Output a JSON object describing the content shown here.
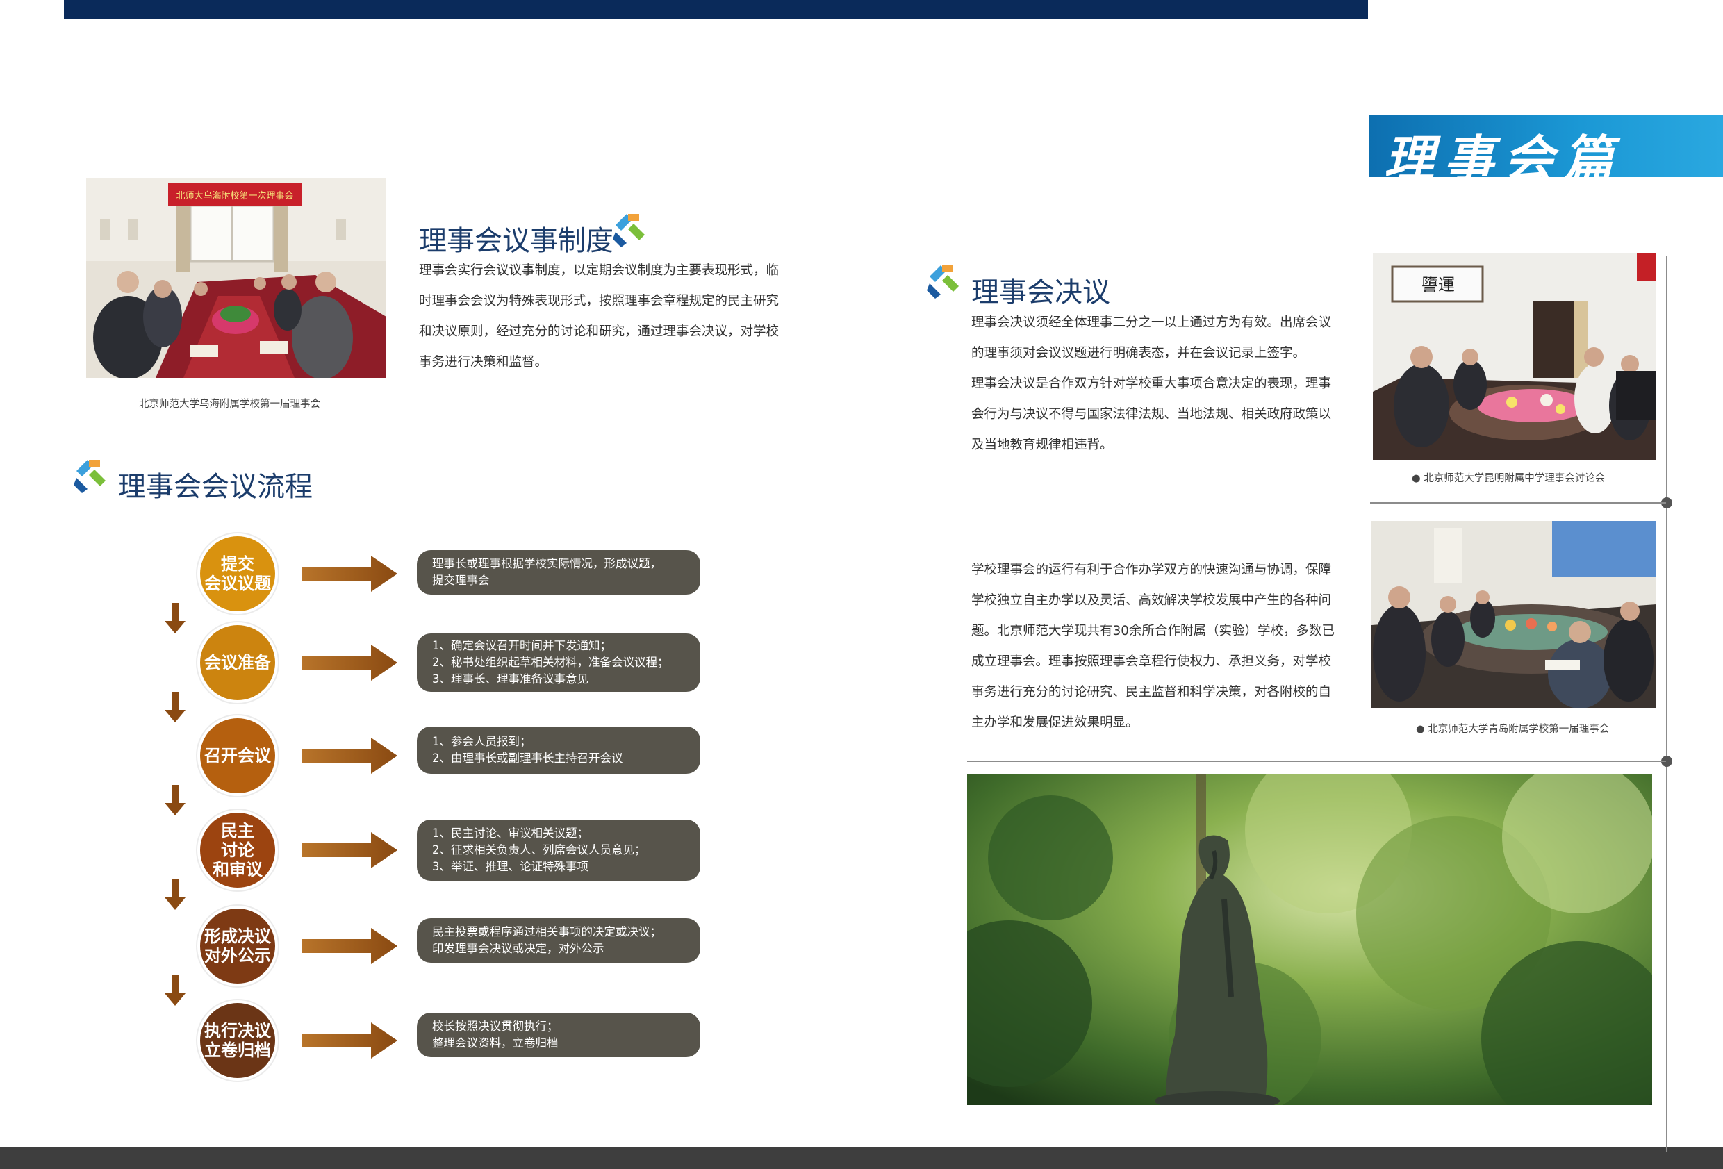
{
  "section_title": "理事会篇",
  "meeting_system": {
    "title": "理事会议事制度",
    "body": "理事会实行会议议事制度，以定期会议制度为主要表现形式，临时理事会会议为特殊表现形式，按照理事会章程规定的民主研究和决议原则，经过充分的讨论和研究，通过理事会决议，对学校事务进行决策和监督。",
    "photo_caption": "北京师范大学乌海附属学校第一届理事会",
    "banner_text": "北师大乌海附校第一次理事会"
  },
  "meeting_process": {
    "title": "理事会会议流程",
    "steps": [
      {
        "label_lines": [
          "提交",
          "会议议题"
        ],
        "color": "#d9920f",
        "desc": [
          "理事长或理事根据学校实际情况，形成议题，",
          "提交理事会"
        ]
      },
      {
        "label_lines": [
          "会议准备"
        ],
        "color": "#cc840f",
        "desc": [
          "1、确定会议召开时间并下发通知；",
          "2、秘书处组织起草相关材料，准备会议议程；",
          "3、理事长、理事准备议事意见"
        ]
      },
      {
        "label_lines": [
          "召开会议"
        ],
        "color": "#b5600f",
        "desc": [
          "1、参会人员报到；",
          "2、由理事长或副理事长主持召开会议"
        ]
      },
      {
        "label_lines": [
          "民主",
          "讨论",
          "和审议"
        ],
        "color": "#9c4410",
        "desc": [
          "1、民主讨论、审议相关议题；",
          "2、征求相关负责人、列席会议人员意见；",
          "3、举证、推理、论证特殊事项"
        ]
      },
      {
        "label_lines": [
          "形成决议",
          "对外公示"
        ],
        "color": "#7e3a14",
        "desc": [
          "民主投票或程序通过相关事项的决定或决议；",
          "印发理事会决议或决定，对外公示"
        ]
      },
      {
        "label_lines": [
          "执行决议",
          "立卷归档"
        ],
        "color": "#6b3516",
        "desc": [
          "校长按照决议贯彻执行；",
          "整理会议资料，立卷归档"
        ]
      }
    ]
  },
  "resolution": {
    "title": "理事会决议",
    "body_lines": [
      "理事会决议须经全体理事二分之一以上通过方为有效。出席会议",
      "的理事须对会议议题进行明确表态，并在会议记录上签字。",
      "理事会决议是合作双方针对学校重大事项合意决定的表现，理事",
      "会行为与决议不得与国家法律法规、当地法规、相关政府政策以",
      "及当地教育规律相违背。"
    ]
  },
  "operation": {
    "body_lines": [
      "学校理事会的运行有利于合作办学双方的快速沟通与协调，保障",
      "学校独立自主办学以及灵活、高效解决学校发展中产生的各种问",
      "题。北京师范大学现共有30余所合作附属（实验）学校，多数已",
      "成立理事会。理事按照理事会章程行使权力、承担义务，对学校",
      "事务进行充分的讨论研究、民主监督和科学决策，对各附校的自",
      "主办学和发展促进效果明显。"
    ]
  },
  "photos_right": {
    "kunming_caption": "● 北京师范大学昆明附属中学理事会讨论会",
    "qingdao_caption": "● 北京师范大学青岛附属学校第一届理事会"
  },
  "colors": {
    "navy": "#0a2a5a",
    "blue_tag": "#1b98d5",
    "heading": "#1b3c6b",
    "step_box": "#57544b",
    "arrow": "#8a4a12"
  }
}
